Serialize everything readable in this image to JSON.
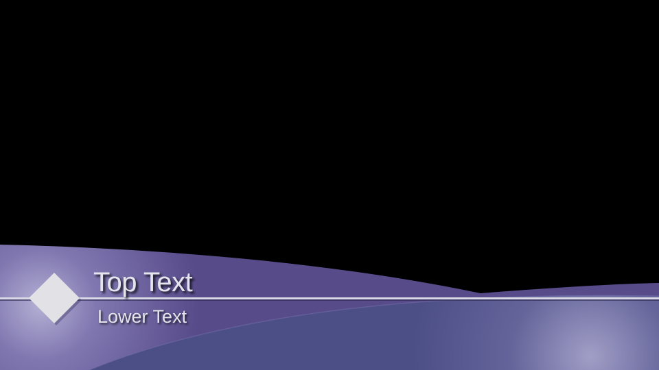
{
  "slide": {
    "top_text": "Top Text",
    "lower_text": "Lower Text"
  },
  "colors": {
    "background": "#000000",
    "band_main": "#5a4d8c",
    "band_lower": "#4e5088",
    "highlight": "#a6a3c6",
    "rule_line": "#d9d9e6",
    "diamond": "#e2e2e6",
    "text": "#e4e4ec"
  },
  "icons": {
    "diamond": "diamond-shape"
  }
}
